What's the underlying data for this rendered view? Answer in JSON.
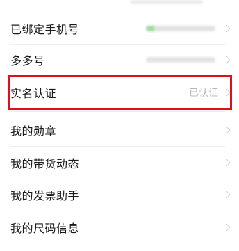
{
  "settings": {
    "rows": [
      {
        "label": "已绑定手机号",
        "value": ""
      },
      {
        "label": "多多号",
        "value": ""
      },
      {
        "label": "实名认证",
        "value": "已认证"
      },
      {
        "label": "我的勋章",
        "value": ""
      },
      {
        "label": "我的带货动态",
        "value": ""
      },
      {
        "label": "我的发票助手",
        "value": ""
      },
      {
        "label": "我的尺码信息",
        "value": ""
      }
    ]
  },
  "annotation": {
    "highlight_color": "#e0101a",
    "highlighted_row": "实名认证"
  },
  "colors": {
    "text": "#1a1a1a",
    "secondary_text": "#b8b8b8",
    "divider": "#eeeeee",
    "blur_green": "#9fdc9f"
  },
  "icons": {
    "row_arrow": "chevron-right-icon"
  }
}
